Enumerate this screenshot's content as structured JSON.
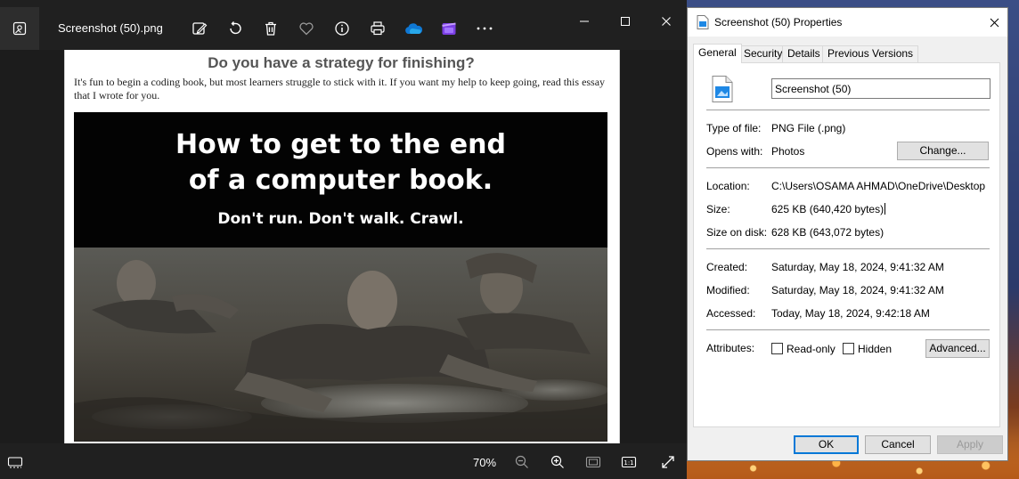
{
  "photos": {
    "file_title": "Screenshot (50).png",
    "zoom_level": "70%",
    "toolbar_icons": [
      "edit-image-icon",
      "rotate-icon",
      "delete-icon",
      "favorite-icon",
      "info-icon",
      "print-icon",
      "onedrive-icon",
      "clipchamp-icon",
      "more-icon"
    ],
    "image": {
      "heading": "Do you have a strategy for finishing?",
      "paragraph": "It's fun to begin a coding book, but most learners struggle to stick with it. If you want my help to keep going, read this essay that I wrote for you.",
      "banner_line1": "How to get to the end",
      "banner_line2": "of a computer book.",
      "banner_sub": "Don't run. Don't walk. Crawl."
    }
  },
  "dialog": {
    "title": "Screenshot (50) Properties",
    "tabs": [
      {
        "label": "General",
        "active": true
      },
      {
        "label": "Security",
        "active": false
      },
      {
        "label": "Details",
        "active": false
      },
      {
        "label": "Previous Versions",
        "active": false
      }
    ],
    "file_name": "Screenshot (50)",
    "type_label": "Type of file:",
    "type_value": "PNG File (.png)",
    "opens_label": "Opens with:",
    "opens_value": "Photos",
    "change_button": "Change...",
    "location_label": "Location:",
    "location_value": "C:\\Users\\OSAMA AHMAD\\OneDrive\\Desktop",
    "size_label": "Size:",
    "size_value": "625 KB (640,420 bytes)",
    "size_disk_label": "Size on disk:",
    "size_disk_value": "628 KB (643,072 bytes)",
    "created_label": "Created:",
    "created_value": "Saturday, May 18, 2024, 9:41:32 AM",
    "modified_label": "Modified:",
    "modified_value": "Saturday, May 18, 2024, 9:41:32 AM",
    "accessed_label": "Accessed:",
    "accessed_value": "Today, May 18, 2024, 9:42:18 AM",
    "attributes_label": "Attributes:",
    "readonly_label": "Read-only",
    "hidden_label": "Hidden",
    "advanced_button": "Advanced...",
    "ok_button": "OK",
    "cancel_button": "Cancel",
    "apply_button": "Apply"
  },
  "colors": {
    "photos_bg": "#1f1f1f",
    "dialog_bg": "#f0f0f0",
    "ok_border": "#0078d7",
    "onedrive_blue": "#0f78d4",
    "clipchamp_purple": "#7b3fe4"
  }
}
